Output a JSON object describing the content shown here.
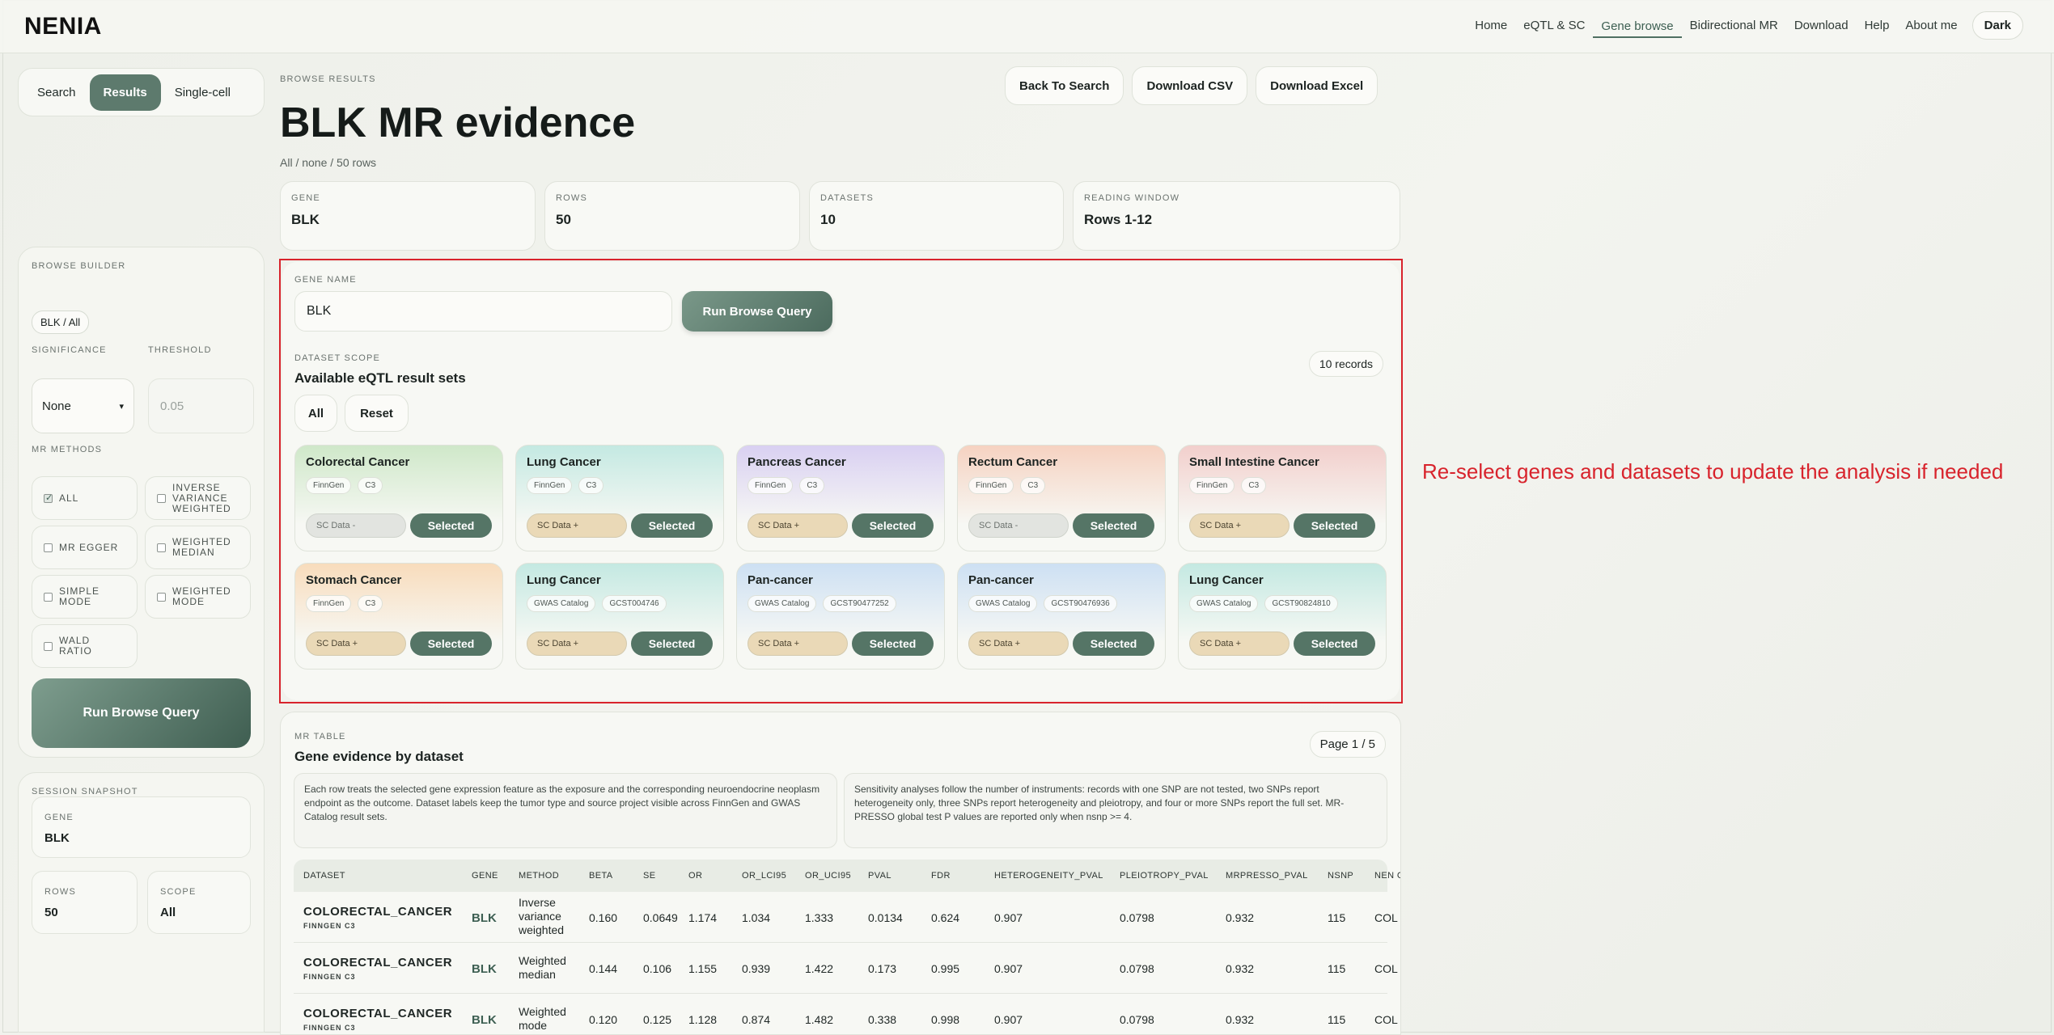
{
  "brand": "NENIA",
  "nav": [
    "Home",
    "eQTL & SC",
    "Gene browse",
    "Bidirectional MR",
    "Download",
    "Help",
    "About me"
  ],
  "nav_active": "Gene browse",
  "dark_label": "Dark",
  "tabs": [
    "Search",
    "Results",
    "Single-cell"
  ],
  "tabs_active": "Results",
  "header": {
    "kicker": "BROWSE RESULTS",
    "title": "BLK MR evidence",
    "subtitle": "All / none / 50 rows",
    "actions": [
      "Back To Search",
      "Download CSV",
      "Download Excel"
    ]
  },
  "stats": [
    {
      "label": "GENE",
      "value": "BLK"
    },
    {
      "label": "ROWS",
      "value": "50"
    },
    {
      "label": "DATASETS",
      "value": "10"
    },
    {
      "label": "READING WINDOW",
      "value": "Rows 1-12"
    }
  ],
  "builder": {
    "kicker": "BROWSE BUILDER",
    "chip": "BLK / All",
    "significance_label": "SIGNIFICANCE",
    "significance_value": "None",
    "threshold_label": "THRESHOLD",
    "threshold_placeholder": "0.05",
    "methods_label": "MR METHODS",
    "methods": [
      "ALL",
      "INVERSE VARIANCE WEIGHTED",
      "MR EGGER",
      "WEIGHTED MEDIAN",
      "SIMPLE MODE",
      "WEIGHTED MODE",
      "WALD RATIO"
    ],
    "run_label": "Run Browse Query"
  },
  "snapshot": {
    "kicker": "SESSION SNAPSHOT",
    "gene_label": "GENE",
    "gene_value": "BLK",
    "rows_label": "ROWS",
    "rows_value": "50",
    "scope_label": "SCOPE",
    "scope_value": "All"
  },
  "query": {
    "gene_name_label": "GENE NAME",
    "gene_value": "BLK",
    "run_label": "Run Browse Query",
    "scope_kicker": "DATASET SCOPE",
    "scope_title": "Available eQTL result sets",
    "records": "10 records",
    "all_label": "All",
    "reset_label": "Reset"
  },
  "datasets": [
    {
      "title": "Colorectal Cancer",
      "source": "FinnGen",
      "code": "C3",
      "sc": "SC Data -",
      "state": "Selected",
      "color": "#cfe8c9"
    },
    {
      "title": "Lung Cancer",
      "source": "FinnGen",
      "code": "C3",
      "sc": "SC Data +",
      "state": "Selected",
      "color": "#c4e9e2"
    },
    {
      "title": "Pancreas Cancer",
      "source": "FinnGen",
      "code": "C3",
      "sc": "SC Data +",
      "state": "Selected",
      "color": "#d9d0f2"
    },
    {
      "title": "Rectum Cancer",
      "source": "FinnGen",
      "code": "C3",
      "sc": "SC Data -",
      "state": "Selected",
      "color": "#f6d2c1"
    },
    {
      "title": "Small Intestine Cancer",
      "source": "FinnGen",
      "code": "C3",
      "sc": "SC Data +",
      "state": "Selected",
      "color": "#f2cfcc"
    },
    {
      "title": "Stomach Cancer",
      "source": "FinnGen",
      "code": "C3",
      "sc": "SC Data +",
      "state": "Selected",
      "color": "#f8dcbc"
    },
    {
      "title": "Lung Cancer",
      "source": "GWAS Catalog",
      "code": "GCST004746",
      "sc": "SC Data +",
      "state": "Selected",
      "color": "#c4e9e2"
    },
    {
      "title": "Pan-cancer",
      "source": "GWAS Catalog",
      "code": "GCST90477252",
      "sc": "SC Data +",
      "state": "Selected",
      "color": "#cde0f3"
    },
    {
      "title": "Pan-cancer",
      "source": "GWAS Catalog",
      "code": "GCST90476936",
      "sc": "SC Data +",
      "state": "Selected",
      "color": "#cde0f3"
    },
    {
      "title": "Lung Cancer",
      "source": "GWAS Catalog",
      "code": "GCST90824810",
      "sc": "SC Data +",
      "state": "Selected",
      "color": "#c4e9e2"
    }
  ],
  "note": "Re-select genes and datasets to update the analysis if needed",
  "table": {
    "kicker": "MR TABLE",
    "title": "Gene evidence by dataset",
    "page": "Page 1 / 5",
    "desc1": "Each row treats the selected gene expression feature as the exposure and the corresponding neuroendocrine neoplasm endpoint as the outcome. Dataset labels keep the tumor type and source project visible across FinnGen and GWAS Catalog result sets.",
    "desc2": "Sensitivity analyses follow the number of instruments: records with one SNP are not tested, two SNPs report heterogeneity only, three SNPs report heterogeneity and pleiotropy, and four or more SNPs report the full set. MR-PRESSO global test P values are reported only when nsnp >= 4.",
    "columns": [
      "DATASET",
      "GENE",
      "METHOD",
      "BETA",
      "SE",
      "OR",
      "OR_LCI95",
      "OR_UCI95",
      "PVAL",
      "FDR",
      "HETEROGENEITY_PVAL",
      "PLEIOTROPY_PVAL",
      "MRPRESSO_PVAL",
      "NSNP",
      "NEN C"
    ],
    "rows": [
      {
        "dataset": "COLORECTAL_CANCER",
        "sub": "FINNGEN C3",
        "gene": "BLK",
        "method": [
          "Inverse",
          "variance",
          "weighted"
        ],
        "beta": "0.160",
        "se": "0.0649",
        "or": "1.174",
        "lci": "1.034",
        "uci": "1.333",
        "pval": "0.0134",
        "fdr": "0.624",
        "het": "0.907",
        "plei": "0.0798",
        "mrp": "0.932",
        "nsnp": "115",
        "nen": "COL"
      },
      {
        "dataset": "COLORECTAL_CANCER",
        "sub": "FINNGEN C3",
        "gene": "BLK",
        "method": [
          "Weighted",
          "median"
        ],
        "beta": "0.144",
        "se": "0.106",
        "or": "1.155",
        "lci": "0.939",
        "uci": "1.422",
        "pval": "0.173",
        "fdr": "0.995",
        "het": "0.907",
        "plei": "0.0798",
        "mrp": "0.932",
        "nsnp": "115",
        "nen": "COL"
      },
      {
        "dataset": "COLORECTAL_CANCER",
        "sub": "FINNGEN C3",
        "gene": "BLK",
        "method": [
          "Weighted",
          "mode"
        ],
        "beta": "0.120",
        "se": "0.125",
        "or": "1.128",
        "lci": "0.874",
        "uci": "1.482",
        "pval": "0.338",
        "fdr": "0.998",
        "het": "0.907",
        "plei": "0.0798",
        "mrp": "0.932",
        "nsnp": "115",
        "nen": "COL"
      }
    ]
  }
}
